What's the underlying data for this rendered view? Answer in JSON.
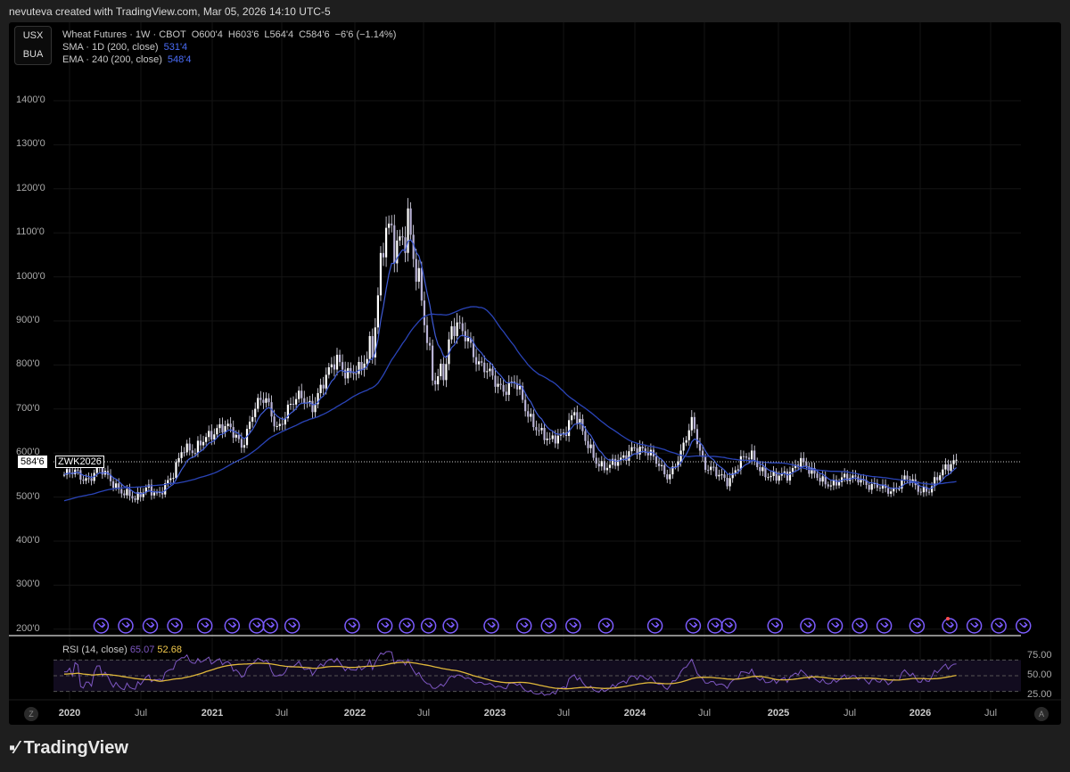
{
  "credit": "nevuteva created with TradingView.com, Mar 05, 2026 14:10 UTC-5",
  "symbol_box": {
    "line1": "USX",
    "line2": "BUA"
  },
  "legend": {
    "title": "Wheat Futures · 1W · CBOT",
    "open": "O600'4",
    "high": "H603'6",
    "low": "L564'4",
    "close": "C584'6",
    "change": "−6'6 (−1.14%)",
    "sma_label": "SMA · 1D (200, close)",
    "sma_value": "531'4",
    "ema_label": "EMA · 240 (200, close)",
    "ema_value": "548'4"
  },
  "current": {
    "price": "584'6",
    "ticker": "ZWK2026"
  },
  "rsi": {
    "label": "RSI (14, close)",
    "value": "65.07",
    "ma_value": "52.68",
    "axis": [
      "75.00",
      "50.00",
      "25.00"
    ]
  },
  "price_axis": [
    "1400'0",
    "1300'0",
    "1200'0",
    "1100'0",
    "1000'0",
    "900'0",
    "800'0",
    "700'0",
    "600'0",
    "500'0",
    "400'0",
    "300'0",
    "200'0"
  ],
  "time_axis": [
    {
      "t": "2020",
      "y": true
    },
    {
      "t": "Jul"
    },
    {
      "t": "2021",
      "y": true
    },
    {
      "t": "Jul"
    },
    {
      "t": "2022",
      "y": true
    },
    {
      "t": "Jul"
    },
    {
      "t": "2023",
      "y": true
    },
    {
      "t": "Jul"
    },
    {
      "t": "2024",
      "y": true
    },
    {
      "t": "Jul"
    },
    {
      "t": "2025",
      "y": true
    },
    {
      "t": "Jul"
    },
    {
      "t": "2026",
      "y": true
    },
    {
      "t": "Jul"
    }
  ],
  "buttons": {
    "z": "Z",
    "a": "A"
  },
  "brand": "TradingView",
  "colors": {
    "candle": "#e8e6f5",
    "sma": "#3f5bd6",
    "ema": "#2a44b8",
    "rsi": "#7e57c2",
    "rsi_ma": "#e0b83a",
    "event": "#7c5cff"
  },
  "chart_data": {
    "type": "candlestick",
    "interval": "1W",
    "start": "2019-12",
    "monthly_closes": [
      545,
      560,
      540,
      560,
      540,
      510,
      490,
      530,
      500,
      540,
      620,
      595,
      640,
      660,
      650,
      620,
      700,
      720,
      660,
      700,
      730,
      710,
      760,
      820,
      780,
      780,
      860,
      1100,
      1050,
      1150,
      950,
      780,
      800,
      880,
      870,
      800,
      770,
      750,
      760,
      690,
      660,
      620,
      640,
      700,
      620,
      580,
      570,
      580,
      620,
      600,
      580,
      550,
      590,
      680,
      570,
      550,
      540,
      580,
      590,
      560,
      540,
      550,
      590,
      550,
      540,
      530,
      540,
      550,
      520,
      520,
      520,
      540,
      520,
      520,
      550,
      585
    ],
    "ylim": [
      200,
      1400
    ],
    "event_weeks": [
      7,
      16,
      25,
      34,
      45,
      55,
      64,
      69,
      77,
      99,
      111,
      119,
      127,
      135,
      150,
      162,
      171,
      180,
      192,
      210,
      224,
      232,
      237,
      254,
      266,
      276,
      285,
      294,
      306,
      318,
      327,
      336,
      345
    ]
  }
}
